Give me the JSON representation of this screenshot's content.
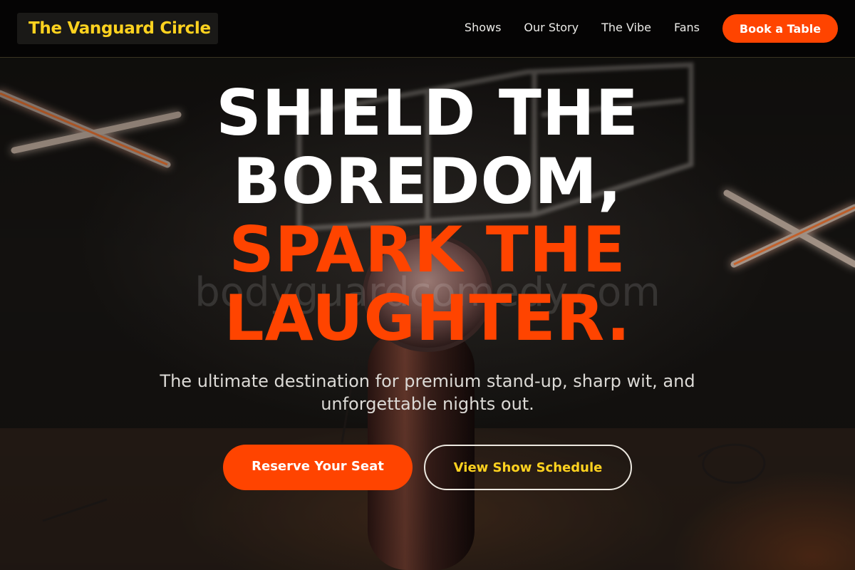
{
  "nav": {
    "brand": "The Vanguard Circle",
    "links": [
      {
        "label": "Shows"
      },
      {
        "label": "Our Story"
      },
      {
        "label": "The Vibe"
      },
      {
        "label": "Fans"
      }
    ],
    "cta": "Book a Table"
  },
  "hero": {
    "headline_white": [
      "SHIELD THE",
      "BOREDOM,"
    ],
    "headline_accent": [
      "SPARK THE",
      "LAUGHTER."
    ],
    "subtitle_line1": "The ultimate destination for premium stand-up, sharp wit, and",
    "subtitle_line2": "unforgettable nights out.",
    "watermark": "bodyguardcomedy.com",
    "primary_button": "Reserve Your Seat",
    "secondary_button": "View Show Schedule"
  },
  "colors": {
    "brand_yellow": "#ffd21f",
    "accent_orange": "#ff4400",
    "background": "#0b0908"
  },
  "icons": [
    "neon-x-light",
    "neon-cube-light",
    "microphone"
  ]
}
